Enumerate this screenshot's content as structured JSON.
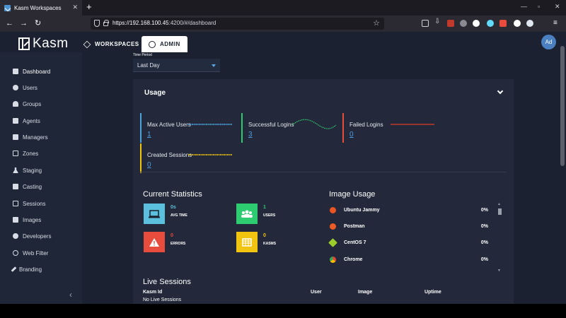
{
  "browser": {
    "tab_title": "Kasm Workspaces",
    "url_host": "https://192.168.100.45",
    "url_rest": ":4200/#/dashboard"
  },
  "app": {
    "logo_text": "Kasm",
    "nav_workspaces": "WORKSPACES",
    "nav_admin": "ADMIN",
    "avatar_initials": "Ad"
  },
  "sidebar": {
    "items": [
      {
        "label": "Dashboard",
        "icon": "grid-icon"
      },
      {
        "label": "Users",
        "icon": "user-icon"
      },
      {
        "label": "Groups",
        "icon": "users-icon"
      },
      {
        "label": "Agents",
        "icon": "agent-icon"
      },
      {
        "label": "Managers",
        "icon": "manager-icon"
      },
      {
        "label": "Zones",
        "icon": "map-icon"
      },
      {
        "label": "Staging",
        "icon": "flask-icon"
      },
      {
        "label": "Casting",
        "icon": "cast-icon"
      },
      {
        "label": "Sessions",
        "icon": "sessions-icon"
      },
      {
        "label": "Images",
        "icon": "image-icon"
      },
      {
        "label": "Developers",
        "icon": "developer-icon"
      },
      {
        "label": "Web Filter",
        "icon": "ban-icon"
      },
      {
        "label": "Branding",
        "icon": "brush-icon"
      }
    ]
  },
  "time_period": {
    "label": "Time Period",
    "value": "Last Day"
  },
  "usage": {
    "title": "Usage",
    "metrics": [
      {
        "label": "Max Active Users",
        "value": "1",
        "color": "#4aa3df"
      },
      {
        "label": "Successful Logins",
        "value": "3",
        "color": "#2ecc71"
      },
      {
        "label": "Failed Logins",
        "value": "0",
        "color": "#e74c3c"
      },
      {
        "label": "Created Sessions",
        "value": "0",
        "color": "#f1c40f"
      }
    ]
  },
  "current_stats": {
    "title": "Current Statistics",
    "items": [
      {
        "value": "0s",
        "label": "AVG TIME",
        "color": "#5bc0de",
        "icon": "laptop-icon"
      },
      {
        "value": "1",
        "label": "USERS",
        "color": "#2ecc71",
        "icon": "users-icon"
      },
      {
        "value": "0",
        "label": "ERRORS",
        "color": "#e74c3c",
        "icon": "warning-icon"
      },
      {
        "value": "0",
        "label": "KASMS",
        "color": "#f1c40f",
        "icon": "kasm-icon"
      }
    ]
  },
  "image_usage": {
    "title": "Image Usage",
    "items": [
      {
        "name": "Ubuntu Jammy",
        "percent": "0%",
        "icon": "ubuntu-icon",
        "color": "#e95420"
      },
      {
        "name": "Postman",
        "percent": "0%",
        "icon": "postman-icon",
        "color": "#ef5b25"
      },
      {
        "name": "CentOS 7",
        "percent": "0%",
        "icon": "centos-icon",
        "color": "#9ccd2a"
      },
      {
        "name": "Chrome",
        "percent": "0%",
        "icon": "chrome-icon",
        "color": "#4285f4"
      }
    ]
  },
  "live_sessions": {
    "title": "Live Sessions",
    "columns": [
      "Kasm Id",
      "User",
      "Image",
      "Uptime"
    ],
    "empty_text": "No Live Sessions"
  }
}
